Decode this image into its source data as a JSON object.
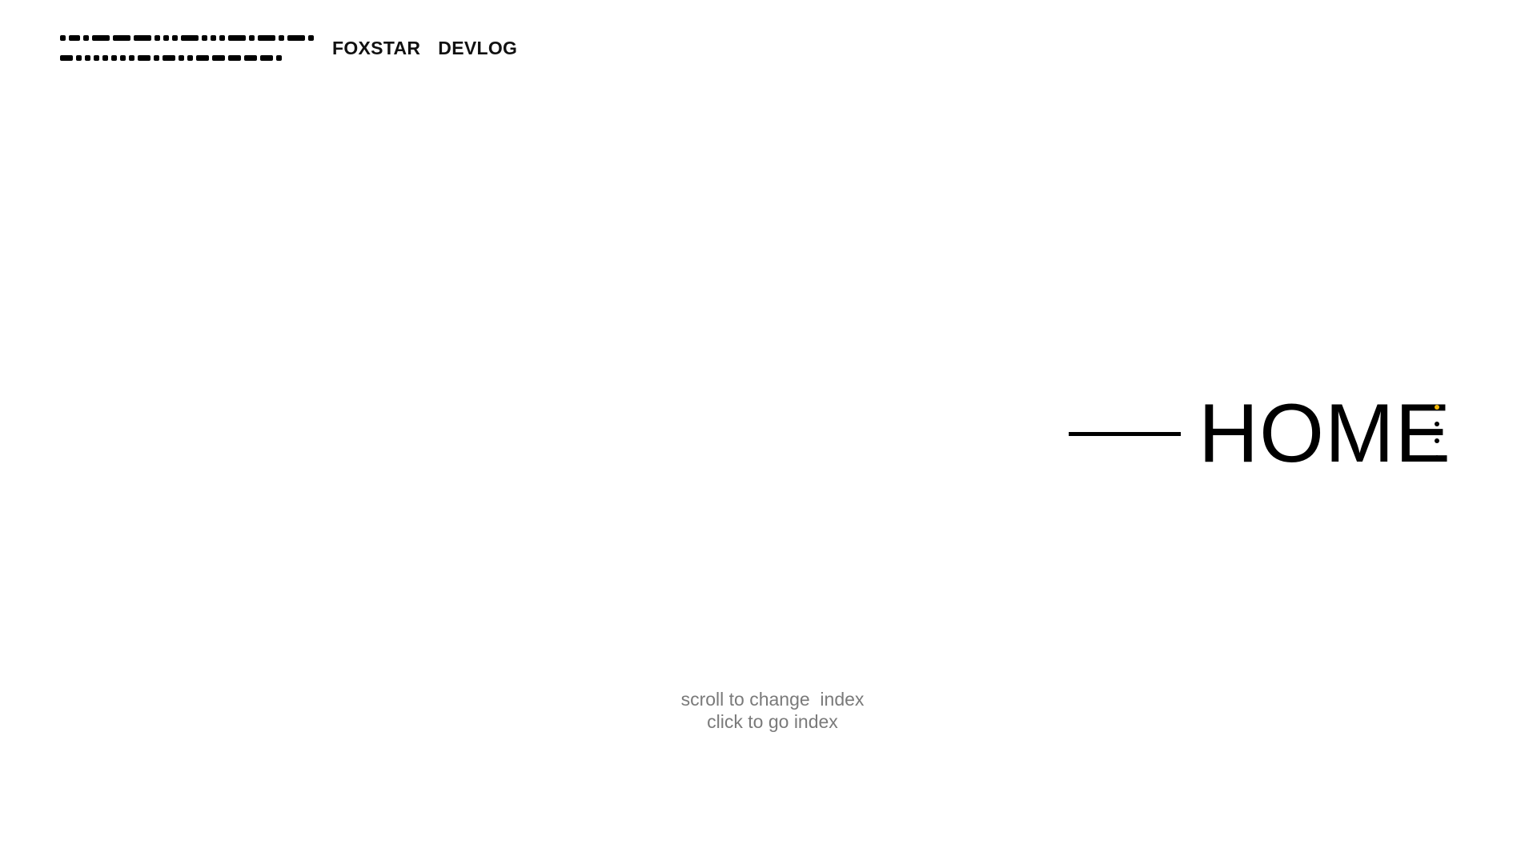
{
  "header": {
    "logo_icon": "morse-code-logo-icon",
    "brand_primary": "FOXSTAR",
    "brand_secondary": "DEVLOG"
  },
  "nav": {
    "current_title": "HOME",
    "index_count": 4,
    "active_index": 0,
    "active_color": "#f2b705"
  },
  "hint": {
    "line1": "scroll to change  index",
    "line2": "click to go index"
  }
}
